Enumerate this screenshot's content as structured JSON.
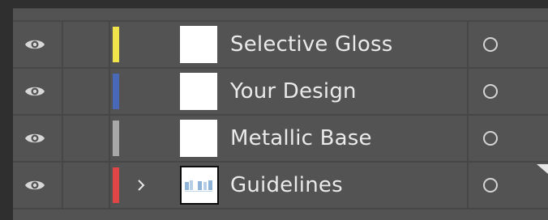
{
  "layers": [
    {
      "name": "Selective Gloss",
      "color": "#f1e44a",
      "visible": true,
      "has_children": false,
      "icon": "eye-icon"
    },
    {
      "name": "Your Design",
      "color": "#4a68b8",
      "visible": true,
      "has_children": false,
      "icon": "eye-icon"
    },
    {
      "name": "Metallic Base",
      "color": "#a8a8a8",
      "visible": true,
      "has_children": false,
      "icon": "eye-icon"
    },
    {
      "name": "Guidelines",
      "color": "#e04646",
      "visible": true,
      "has_children": true,
      "expand_icon": "chevron-right-icon",
      "icon": "eye-icon"
    }
  ],
  "colors": {
    "panel_bg": "#535353",
    "row_separator": "#474747",
    "text": "#eaeaea"
  }
}
